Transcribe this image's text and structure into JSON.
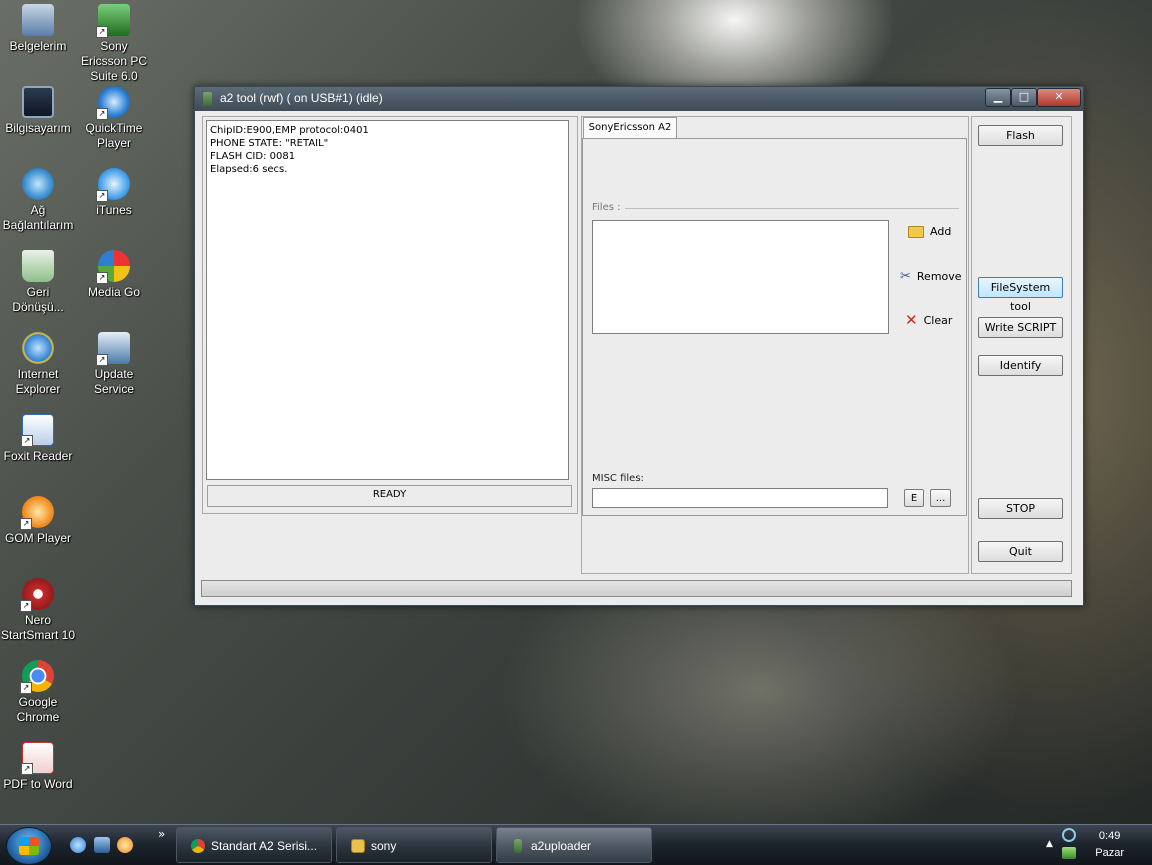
{
  "desktop": {
    "icons": [
      {
        "label": "Belgelerim",
        "color": "#5b7da8"
      },
      {
        "label": "Sony Ericsson PC Suite 6.0",
        "color": "#3b8a3b"
      },
      {
        "label": "Bilgisayarım",
        "color": "#2a3d5c"
      },
      {
        "label": "QuickTime Player",
        "color": "#2b7fd4"
      },
      {
        "label": "Ağ Bağlantılarım",
        "color": "#3e8fd0"
      },
      {
        "label": "iTunes",
        "color": "#3d9be8"
      },
      {
        "label": "Geri Dönüşü...",
        "color": "#6fa86a"
      },
      {
        "label": "Media Go",
        "color": "#5aa83c"
      },
      {
        "label": "Internet Explorer",
        "color": "#2e7fd0"
      },
      {
        "label": "Update Service",
        "color": "#4a7aa8"
      },
      {
        "label": "Foxit Reader",
        "color": "#2d6eb5"
      },
      {
        "label": "GOM Player",
        "color": "#f08a1c"
      },
      {
        "label": "Nero StartSmart 10",
        "color": "#c32a2a"
      },
      {
        "label": "Google Chrome",
        "color": "#3aa04a"
      },
      {
        "label": "PDF to Word",
        "color": "#c8302b"
      }
    ]
  },
  "window": {
    "title": "a2 tool (rwf) ( on USB#1) (idle)",
    "controls": {
      "minimize": "▁",
      "maximize": "□",
      "close": "✕"
    },
    "log_lines": [
      "ChipID:E900,EMP protocol:0401",
      "",
      "PHONE STATE: \"RETAIL\"",
      "FLASH CID: 0081",
      "Elapsed:6 secs."
    ],
    "status": "READY",
    "tab_label": "SonyEricsson A2",
    "files_label": "Files :",
    "add_label": "Add",
    "remove_label": "Remove",
    "clear_label": "Clear",
    "misc_label": "MISC files:",
    "misc_value": "",
    "e_button": "E",
    "browse_button": "...",
    "buttons": {
      "flash": "Flash",
      "filesystem": "FileSystem tool",
      "write_script": "Write SCRIPT",
      "identify": "Identify",
      "stop": "STOP",
      "quit": "Quit"
    },
    "progress": 0
  },
  "taskbar": {
    "items": [
      {
        "label": "Standart A2 Serisi...",
        "color": "#3aa04a"
      },
      {
        "label": "sony",
        "color": "#e8c24a"
      },
      {
        "label": "a2uploader",
        "color": "#6b9a5a"
      }
    ],
    "overflow": "»",
    "time": "0:49",
    "day": "Pazar"
  }
}
